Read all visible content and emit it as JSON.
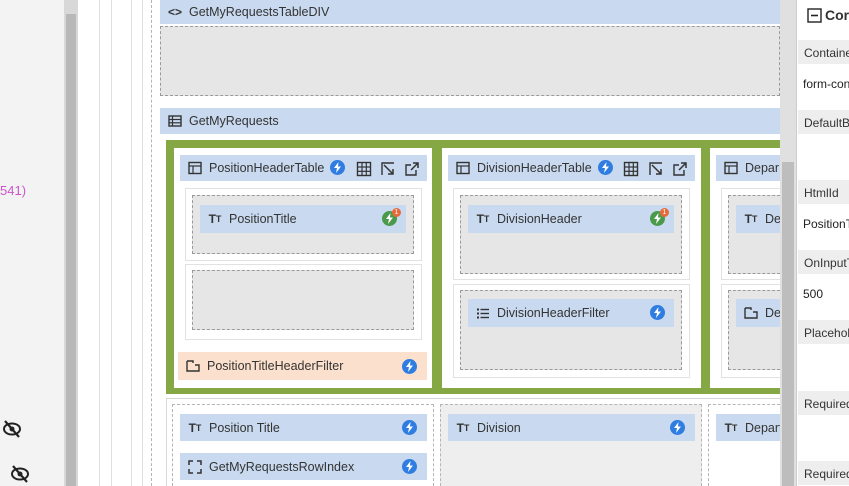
{
  "left": {
    "partial_number": "541)",
    "icons": [
      "eye-off-icon",
      "eye-off-icon"
    ]
  },
  "canvas": {
    "table_div": {
      "label": "GetMyRequestsTableDIV",
      "icon": "code-icon"
    },
    "repeater": {
      "label": "GetMyRequests",
      "icon": "table-list-icon"
    },
    "header_columns": [
      {
        "label": "PositionHeaderTable",
        "icon": "table-icon"
      },
      {
        "label": "DivisionHeaderTable",
        "icon": "table-icon"
      },
      {
        "label": "Depar",
        "icon": "table-icon"
      }
    ],
    "position_title": {
      "label": "PositionTitle",
      "icon": "text-icon",
      "badge": "1"
    },
    "division_header": {
      "label": "DivisionHeader",
      "icon": "text-icon",
      "badge": "1"
    },
    "division_header_filter": {
      "label": "DivisionHeaderFilter",
      "icon": "list-icon"
    },
    "position_title_header_filter": {
      "label": "PositionTitleHeaderFilter",
      "icon": "dropdown-icon"
    },
    "third_col_text": {
      "label": "De",
      "icon": "text-icon"
    },
    "third_col_filter": {
      "label": "De",
      "icon": "dropdown-icon"
    },
    "row_cells": [
      {
        "label": "Position Title",
        "icon": "text-icon"
      },
      {
        "label": "Division",
        "icon": "text-icon"
      },
      {
        "label": "Depart",
        "icon": "text-icon"
      }
    ],
    "row_index": {
      "label": "GetMyRequestsRowIndex",
      "icon": "expand-icon"
    }
  },
  "properties": {
    "title": "Cor",
    "rows": [
      {
        "label": "Containe",
        "value": "form-con"
      },
      {
        "label": "DefaultB",
        "value": ""
      },
      {
        "label": "HtmlId",
        "value": "PositionT"
      },
      {
        "label": "OnInputT",
        "value": "500"
      },
      {
        "label": "Placehol",
        "value": ""
      },
      {
        "label": "Required",
        "value": ""
      },
      {
        "label": "Required",
        "value": ""
      }
    ]
  },
  "colors": {
    "header_blue": "#c9daf0",
    "green_band": "#86a844",
    "filter_peach": "#fbe1cd",
    "bolt_blue": "#2f7de1"
  }
}
